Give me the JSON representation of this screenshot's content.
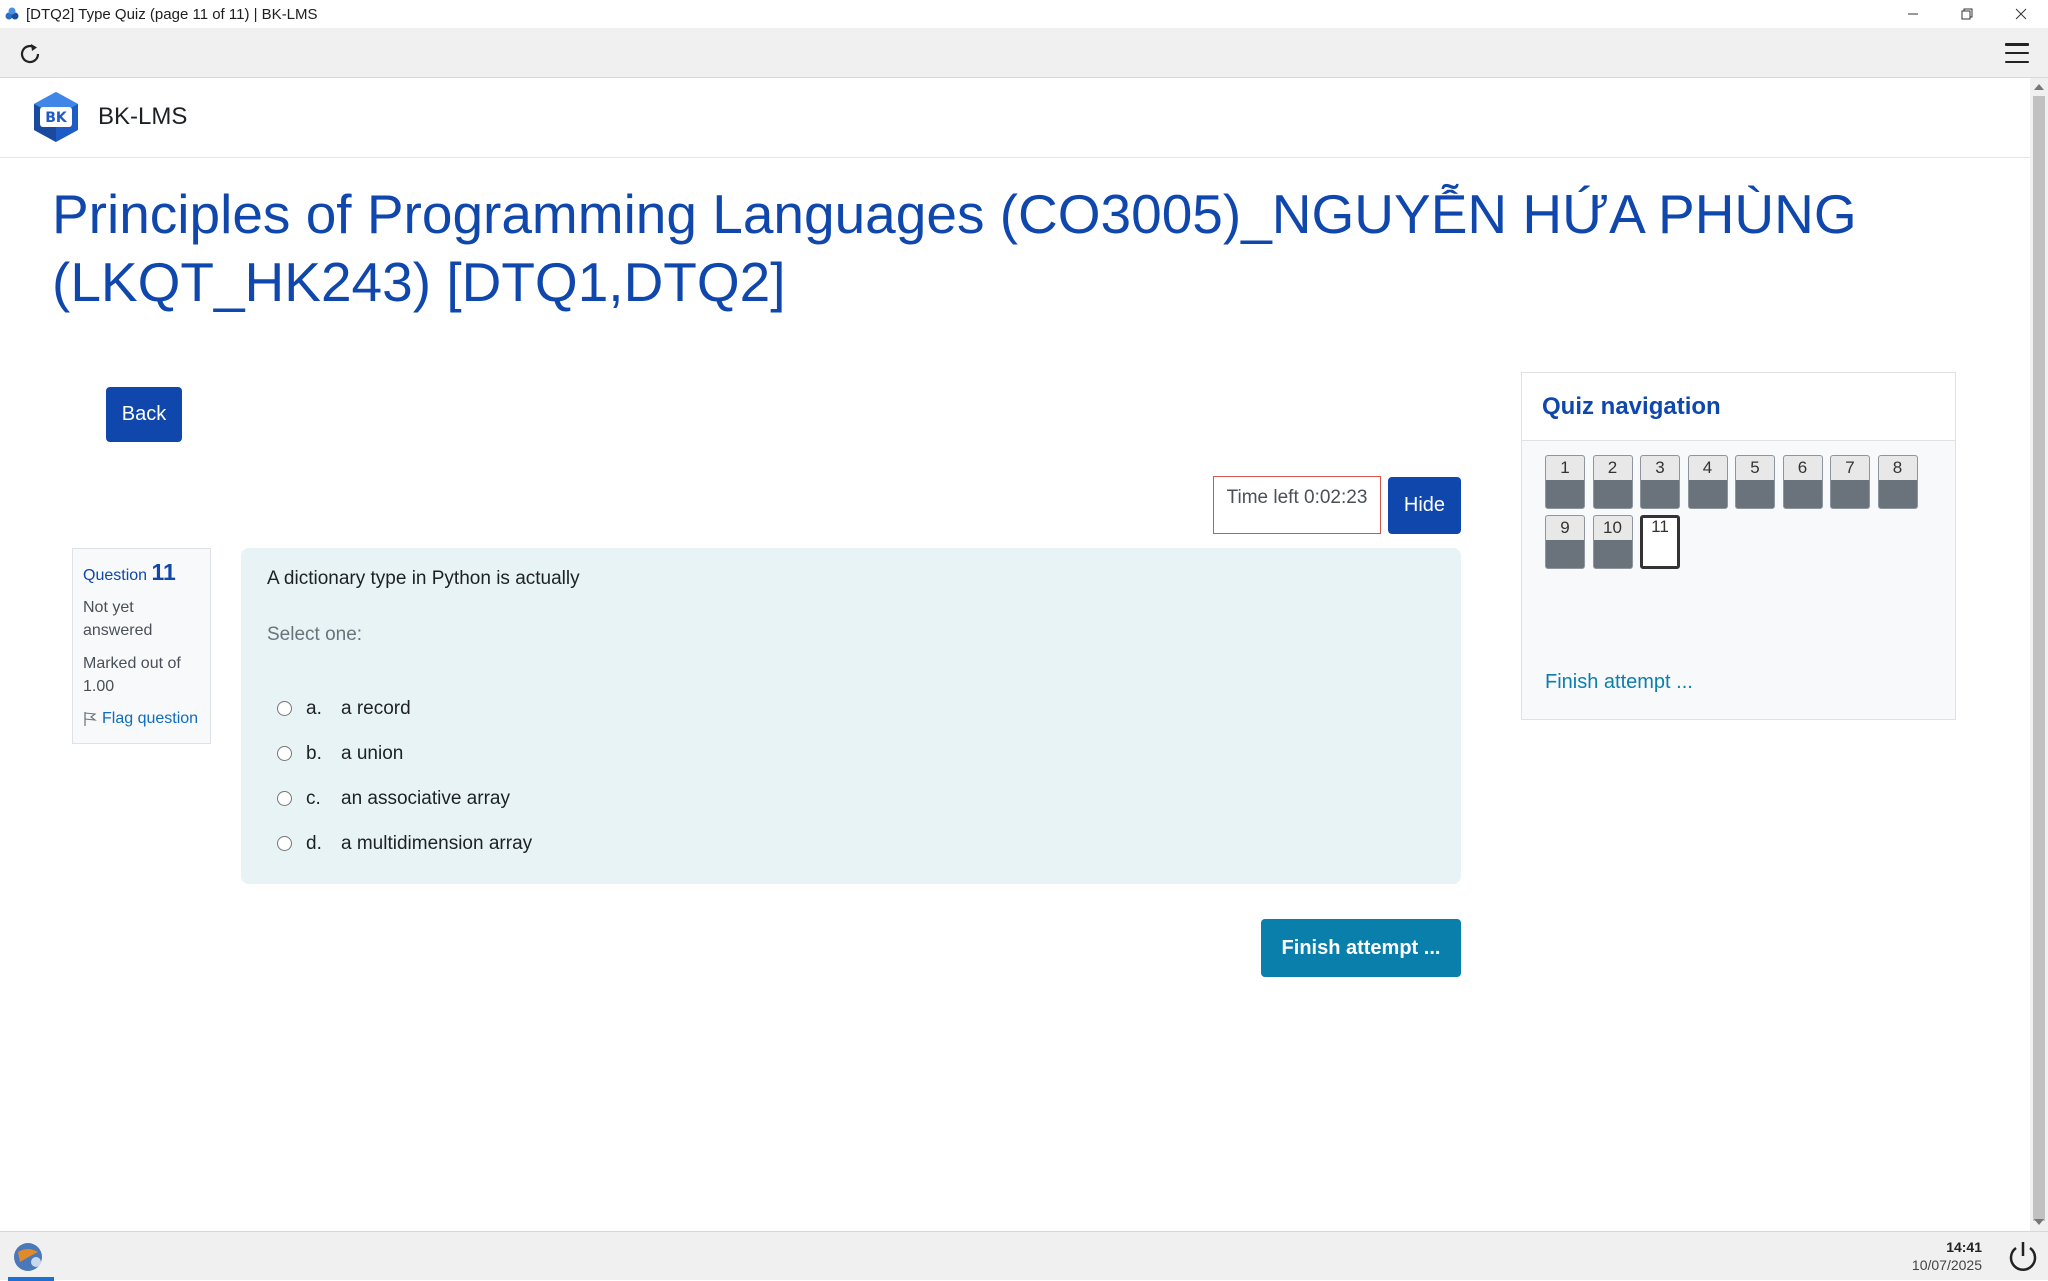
{
  "window": {
    "title": "[DTQ2] Type Quiz (page 11 of 11) | BK-LMS"
  },
  "header": {
    "site_name": "BK-LMS",
    "logo_text": "BK"
  },
  "course": {
    "title": "Principles of Programming Languages (CO3005)_NGUYỄN HỨA PHÙNG (LKQT_HK243) [DTQ1,DTQ2]"
  },
  "actions": {
    "back_label": "Back",
    "hide_label": "Hide",
    "finish_label": "Finish attempt ..."
  },
  "timer": {
    "text": "Time left 0:02:23"
  },
  "question": {
    "label": "Question",
    "number": "11",
    "state": "Not yet answered",
    "grade": "Marked out of 1.00",
    "flag_label": "Flag question",
    "text": "A dictionary type in Python is actually",
    "prompt": "Select one:",
    "answers": [
      {
        "letter": "a.",
        "text": "a record"
      },
      {
        "letter": "b.",
        "text": "a union"
      },
      {
        "letter": "c.",
        "text": "an associative array"
      },
      {
        "letter": "d.",
        "text": "a multidimension array"
      }
    ]
  },
  "quiz_nav": {
    "title": "Quiz navigation",
    "questions": [
      "1",
      "2",
      "3",
      "4",
      "5",
      "6",
      "7",
      "8",
      "9",
      "10",
      "11"
    ],
    "current": "11",
    "finish_label": "Finish attempt ..."
  },
  "taskbar": {
    "time": "14:41",
    "date": "10/07/2025"
  },
  "colors": {
    "primary": "#0f47ad",
    "finish": "#0b7fab",
    "question_bg": "#e7f3f5",
    "timer_border": "#d9534f"
  }
}
